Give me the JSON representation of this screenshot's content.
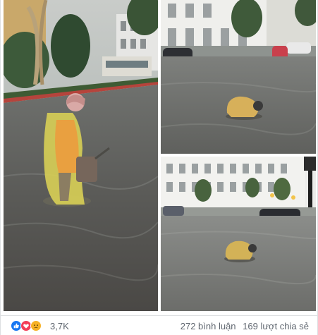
{
  "reactions": {
    "count": "3,7K",
    "icons": [
      "like-icon",
      "love-icon",
      "sad-icon"
    ],
    "colors": {
      "like": "#1877f2",
      "love": "#f33e58",
      "sad": "#f7b125"
    }
  },
  "stats": {
    "comments": "272 bình luận",
    "shares": "169 lượt chia sẻ"
  },
  "photos": [
    {
      "subject": "worker-in-yellow-raincoat-flooded-street"
    },
    {
      "subject": "worker-crouching-in-flood-water"
    },
    {
      "subject": "worker-clearing-drain-wide-street"
    }
  ]
}
